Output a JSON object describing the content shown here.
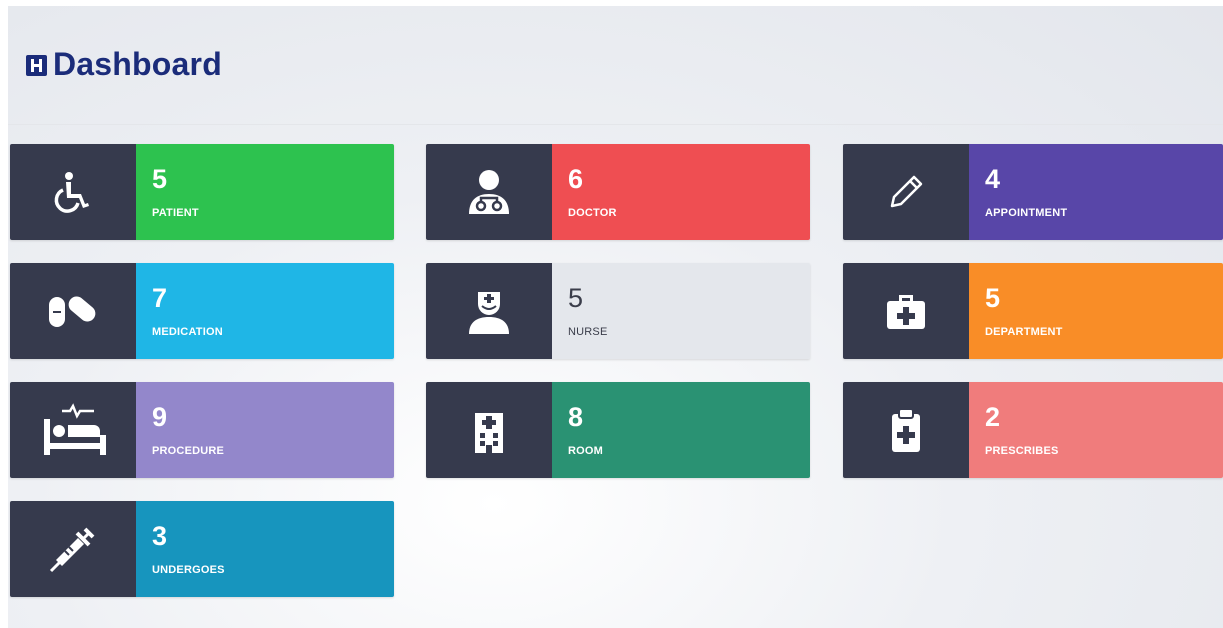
{
  "header": {
    "title": "Dashboard",
    "logo_icon": "hospital-h-icon"
  },
  "colors": {
    "icon_box": "#363a4d",
    "title": "#1b2c7a"
  },
  "cards": [
    {
      "count": "5",
      "label": "PATIENT",
      "icon": "wheelchair-icon",
      "color": "#2dc24f",
      "text_color": "#ffffff"
    },
    {
      "count": "6",
      "label": "DOCTOR",
      "icon": "doctor-icon",
      "color": "#ef4e52",
      "text_color": "#ffffff"
    },
    {
      "count": "4",
      "label": "APPOINTMENT",
      "icon": "pencil-icon",
      "color": "#5846a8",
      "text_color": "#ffffff"
    },
    {
      "count": "7",
      "label": "MEDICATION",
      "icon": "pills-icon",
      "color": "#1fb6e6",
      "text_color": "#ffffff"
    },
    {
      "count": "5",
      "label": "NURSE",
      "icon": "nurse-icon",
      "color": "#e4e7ec",
      "text_color": "#3a3d4a"
    },
    {
      "count": "5",
      "label": "DEPARTMENT",
      "icon": "medkit-icon",
      "color": "#f98d27",
      "text_color": "#ffffff"
    },
    {
      "count": "9",
      "label": "PROCEDURE",
      "icon": "hospital-bed-icon",
      "color": "#9387cb",
      "text_color": "#ffffff"
    },
    {
      "count": "8",
      "label": "ROOM",
      "icon": "hospital-building-icon",
      "color": "#2a9273",
      "text_color": "#ffffff"
    },
    {
      "count": "2",
      "label": "PRESCRIBES",
      "icon": "clipboard-plus-icon",
      "color": "#f07c7c",
      "text_color": "#ffffff"
    },
    {
      "count": "3",
      "label": "UNDERGOES",
      "icon": "syringe-icon",
      "color": "#1795be",
      "text_color": "#ffffff"
    }
  ]
}
